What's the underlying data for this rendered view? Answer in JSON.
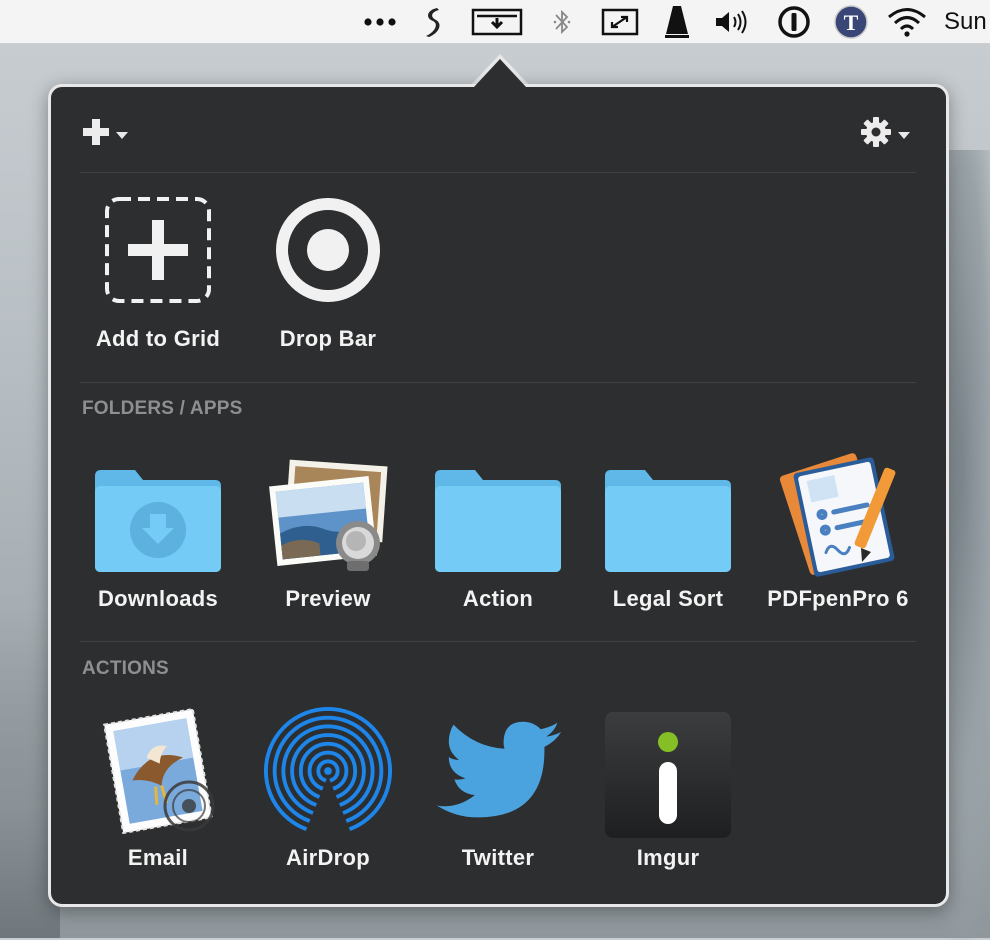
{
  "menubar": {
    "clock": "Sun",
    "icons": [
      "more-icon",
      "scrivener-icon",
      "dropzone-icon",
      "bluetooth-icon",
      "resize-icon",
      "metronome-icon",
      "volume-icon",
      "onepassword-icon",
      "textexpander-icon",
      "wifi-icon"
    ]
  },
  "toolbar": {
    "add_icon": "plus-icon",
    "settings_icon": "gear-icon"
  },
  "top_grid": [
    {
      "label": "Add to Grid",
      "icon": "add-to-grid-icon"
    },
    {
      "label": "Drop Bar",
      "icon": "drop-bar-icon"
    }
  ],
  "sections": {
    "folders_apps": "FOLDERS / APPS",
    "actions": "ACTIONS"
  },
  "folders_apps": [
    {
      "label": "Downloads",
      "icon": "downloads-folder-icon"
    },
    {
      "label": "Preview",
      "icon": "preview-app-icon"
    },
    {
      "label": "Action",
      "icon": "folder-icon"
    },
    {
      "label": "Legal Sort",
      "icon": "folder-icon"
    },
    {
      "label": "PDFpenPro 6",
      "icon": "pdfpenpro-app-icon"
    }
  ],
  "actions": [
    {
      "label": "Email",
      "icon": "mail-stamp-icon"
    },
    {
      "label": "AirDrop",
      "icon": "airdrop-icon"
    },
    {
      "label": "Twitter",
      "icon": "twitter-bird-icon"
    },
    {
      "label": "Imgur",
      "icon": "imgur-icon"
    }
  ],
  "colors": {
    "popover_bg": "#2d2e2f",
    "folder_blue": "#6cc6f4",
    "airdrop_blue": "#1e86ea",
    "twitter_blue": "#4aa3df",
    "imgur_green": "#85bf25"
  }
}
